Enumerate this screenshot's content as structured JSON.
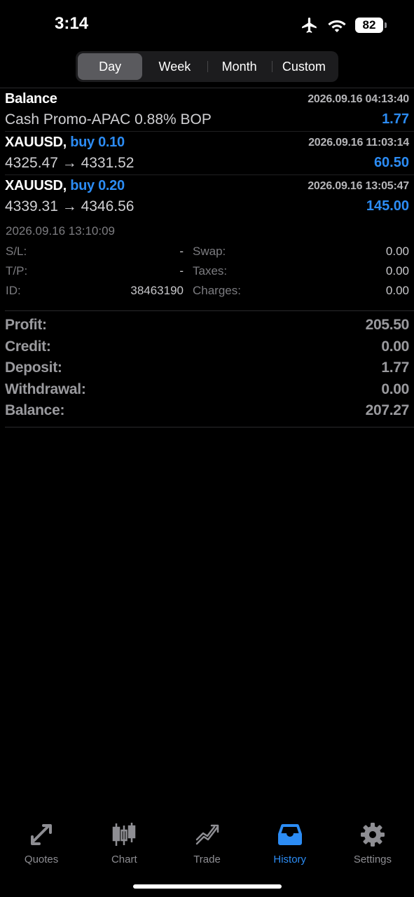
{
  "status": {
    "time": "3:14",
    "battery": "82"
  },
  "periods": {
    "tabs": [
      "Day",
      "Week",
      "Month",
      "Custom"
    ],
    "active": "Day"
  },
  "deals": [
    {
      "title": "Balance",
      "title_action": "",
      "time": "2026.09.16 04:13:40",
      "subtitle": "Cash Promo-APAC 0.88% BOP",
      "value": "1.77"
    },
    {
      "title": "XAUUSD,",
      "title_action": "buy 0.10",
      "time": "2026.09.16 11:03:14",
      "subtitle": "4325.47 → 4331.52",
      "value": "60.50"
    },
    {
      "title": "XAUUSD,",
      "title_action": "buy 0.20",
      "time": "2026.09.16 13:05:47",
      "subtitle": "4339.31 → 4346.56",
      "value": "145.00"
    }
  ],
  "details": {
    "close_time": "2026.09.16 13:10:09",
    "sl_label": "S/L:",
    "sl_value": "-",
    "tp_label": "T/P:",
    "tp_value": "-",
    "id_label": "ID:",
    "id_value": "38463190",
    "swap_label": "Swap:",
    "swap_value": "0.00",
    "taxes_label": "Taxes:",
    "taxes_value": "0.00",
    "charges_label": "Charges:",
    "charges_value": "0.00"
  },
  "summary": {
    "profit_label": "Profit:",
    "profit_value": "205.50",
    "credit_label": "Credit:",
    "credit_value": "0.00",
    "deposit_label": "Deposit:",
    "deposit_value": "1.77",
    "withdrawal_label": "Withdrawal:",
    "withdrawal_value": "0.00",
    "balance_label": "Balance:",
    "balance_value": "207.27"
  },
  "tabbar": {
    "quotes": "Quotes",
    "chart": "Chart",
    "trade": "Trade",
    "history": "History",
    "settings": "Settings",
    "active": "History",
    "active_color": "#2c8cf4",
    "inactive_color": "#8e8e93"
  }
}
